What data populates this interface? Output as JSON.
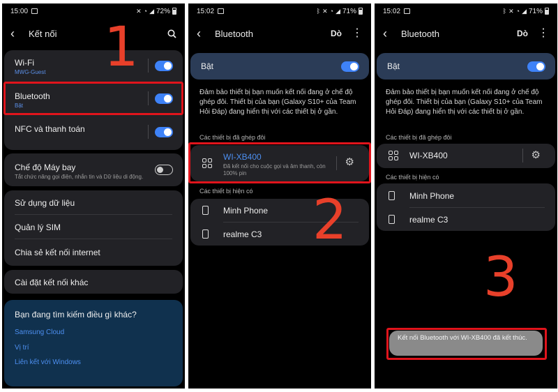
{
  "status": {
    "time1": "15:00",
    "battery1": "72%",
    "time2": "15:02",
    "battery2": "71%",
    "time3": "15:02",
    "battery3": "71%"
  },
  "screen1": {
    "title": "Kết nối",
    "wifi": {
      "label": "Wi-Fi",
      "sub": "MWG-Guest",
      "on": true
    },
    "bluetooth": {
      "label": "Bluetooth",
      "sub": "Bật",
      "on": true
    },
    "nfc": {
      "label": "NFC và thanh toán",
      "on": true
    },
    "airplane": {
      "label": "Chế độ Máy bay",
      "sub": "Tắt chức năng gọi điện, nhắn tin và Dữ liệu di động.",
      "on": false
    },
    "data_usage": "Sử dụng dữ liệu",
    "sim": "Quản lý SIM",
    "hotspot": "Chia sẻ kết nối internet",
    "more_settings": "Cài đặt kết nối khác",
    "suggest": {
      "title": "Bạn đang tìm kiếm điều gì khác?",
      "links": [
        "Samsung Cloud",
        "Vị trí",
        "Liên kết với Windows"
      ]
    }
  },
  "screen2": {
    "title": "Bluetooth",
    "scan": "Dò",
    "on_label": "Bật",
    "info": "Đảm bảo thiết bị bạn muốn kết nối đang ở chế độ ghép đôi. Thiết bị của bạn (Galaxy S10+ của Team Hỏi Đáp) đang hiển thị với các thiết bị ở gần.",
    "paired_header": "Các thiết bị đã ghép đôi",
    "paired": {
      "name": "WI-XB400",
      "status": "Đã kết nối cho cuộc gọi và âm thanh, còn 100% pin"
    },
    "available_header": "Các thiết bị hiện có",
    "available": [
      "Minh Phone",
      "realme C3"
    ]
  },
  "screen3": {
    "title": "Bluetooth",
    "scan": "Dò",
    "on_label": "Bật",
    "info": "Đảm bảo thiết bị bạn muốn kết nối đang ở chế độ ghép đôi. Thiết bị của bạn (Galaxy S10+ của Team Hỏi Đáp) đang hiển thị với các thiết bị ở gần.",
    "paired_header": "Các thiết bị đã ghép đôi",
    "paired": {
      "name": "WI-XB400"
    },
    "available_header": "Các thiết bị hiện có",
    "available": [
      "Minh Phone",
      "realme C3"
    ],
    "toast": "Kết nối Bluetooth với WI-XB400 đã kết thúc."
  },
  "steps": [
    "1",
    "2",
    "3"
  ],
  "colors": {
    "accent": "#3e82f7",
    "highlight": "#e0141c",
    "step": "#e8402a"
  }
}
